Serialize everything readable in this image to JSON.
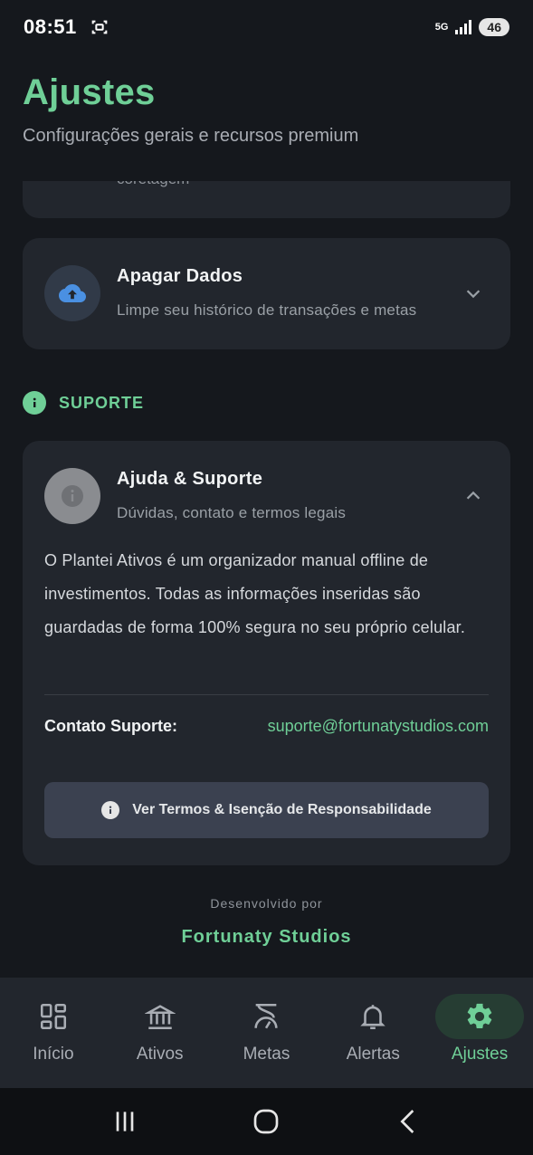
{
  "status_bar": {
    "time": "08:51",
    "network": "5G",
    "battery": "46"
  },
  "header": {
    "title": "Ajustes",
    "subtitle": "Configurações gerais e recursos premium"
  },
  "partial_card": {
    "text": "coretagem"
  },
  "apagar_card": {
    "title": "Apagar Dados",
    "subtitle": "Limpe seu histórico de transações e metas",
    "icon": "cloud-upload-icon"
  },
  "section": {
    "label": "SUPORTE",
    "icon": "info-icon"
  },
  "ajuda_card": {
    "title": "Ajuda & Suporte",
    "subtitle": "Dúvidas, contato e termos legais",
    "description": "O Plantei Ativos é um organizador manual offline de investimentos. Todas as informações inseridas são guardadas de forma 100% segura no seu próprio celular.",
    "contact_label": "Contato Suporte:",
    "contact_email": "suporte@fortunatystudios.com",
    "terms_button": "Ver Termos & Isenção de Responsabilidade"
  },
  "footer": {
    "developed_by": "Desenvolvido por",
    "brand": "Fortunaty Studios"
  },
  "bottom_nav": {
    "items": [
      {
        "label": "Início",
        "icon": "dashboard-icon"
      },
      {
        "label": "Ativos",
        "icon": "bank-icon"
      },
      {
        "label": "Metas",
        "icon": "goal-icon"
      },
      {
        "label": "Alertas",
        "icon": "bell-icon"
      },
      {
        "label": "Ajustes",
        "icon": "gear-icon",
        "active": true
      }
    ]
  },
  "colors": {
    "accent": "#6fcf97",
    "background": "#15181d",
    "card": "#22262d"
  }
}
